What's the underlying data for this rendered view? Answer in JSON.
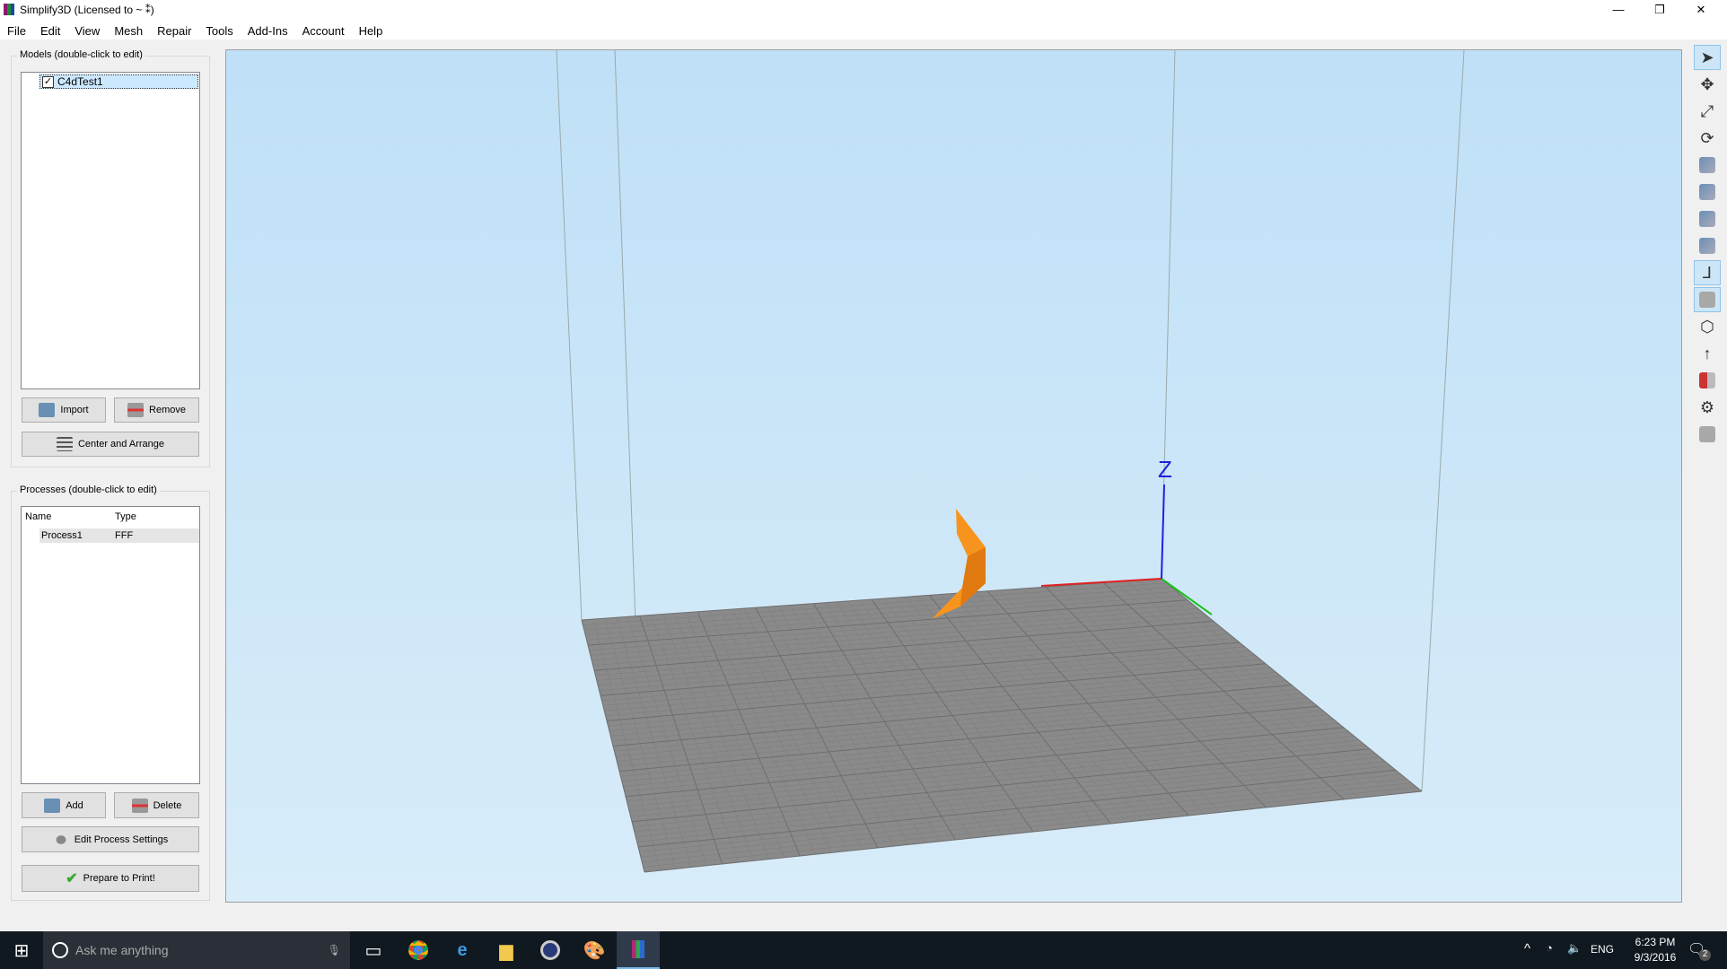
{
  "window": {
    "title": "Simplify3D (Licensed to ~ ⁑)",
    "minimize": "—",
    "restore": "❐",
    "close": "✕"
  },
  "menu": [
    "File",
    "Edit",
    "View",
    "Mesh",
    "Repair",
    "Tools",
    "Add-Ins",
    "Account",
    "Help"
  ],
  "models": {
    "label": "Models (double-click to edit)",
    "items": [
      {
        "name": "C4dTest1",
        "checked": true
      }
    ],
    "import": "Import",
    "remove": "Remove",
    "center": "Center and Arrange"
  },
  "processes": {
    "label": "Processes (double-click to edit)",
    "columns": [
      "Name",
      "Type"
    ],
    "rows": [
      [
        "Process1",
        "FFF"
      ]
    ],
    "add": "Add",
    "delete": "Delete",
    "edit": "Edit Process Settings",
    "prepare": "Prepare to Print!"
  },
  "viewport": {
    "axis_z_label": "Z",
    "colors": {
      "bed": "#8a8a8a",
      "model": "#f7941d",
      "x": "#e02020",
      "y": "#20c020",
      "z": "#2020e0"
    }
  },
  "toolbar": [
    "select-icon",
    "move-icon",
    "scale-icon",
    "rotate-icon",
    "view-default-icon",
    "view-front-icon",
    "view-top-icon",
    "view-side-icon",
    "axes-icon",
    "solid-icon",
    "wireframe-icon",
    "normal-icon",
    "cross-section-icon",
    "settings-icon",
    "supports-icon"
  ],
  "taskbar": {
    "search_placeholder": "Ask me anything",
    "time": "6:23 PM",
    "date": "9/3/2016",
    "lang": "ENG",
    "notifications": "2"
  }
}
